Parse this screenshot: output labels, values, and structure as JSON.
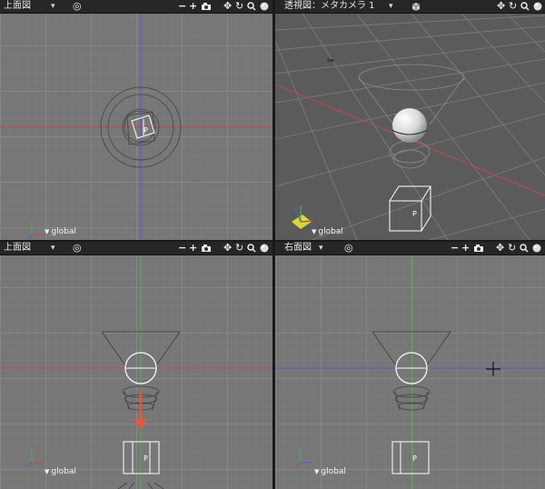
{
  "viewports": {
    "top_left": {
      "title": "上面図",
      "coord_label": "global",
      "p_label": "P"
    },
    "top_right": {
      "title": "透視図：メタカメラ 1",
      "coord_label": "global",
      "p_label": "P"
    },
    "bottom_left": {
      "title": "上面図",
      "coord_label": "global",
      "p_label": "P"
    },
    "bottom_right": {
      "title": "右面図",
      "coord_label": "global",
      "p_label": "P"
    }
  },
  "header_icons": {
    "view_options": "◎",
    "zoom_out": "−",
    "zoom_in": "+",
    "camera": "camera-icon",
    "pan": "✥",
    "rotate": "↻",
    "render_preview": "●",
    "dropdown": "▾"
  },
  "colors": {
    "background": "#777777",
    "perspective_background": "#5b5b5b",
    "header": "#262626",
    "axis_x": "#c04848",
    "axis_y": "#4caf50",
    "axis_z": "#5a5ad0",
    "arrow": "#e8563f"
  }
}
